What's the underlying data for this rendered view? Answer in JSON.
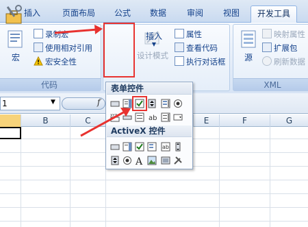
{
  "tabs": [
    {
      "label": "插入",
      "active": false
    },
    {
      "label": "页面布局",
      "active": false
    },
    {
      "label": "公式",
      "active": false
    },
    {
      "label": "数据",
      "active": false
    },
    {
      "label": "审阅",
      "active": false
    },
    {
      "label": "视图",
      "active": false
    },
    {
      "label": "开发工具",
      "active": true
    }
  ],
  "ribbon": {
    "code_group": {
      "label": "代码",
      "macro_button": "宏",
      "record_macro": "录制宏",
      "relative_ref": "使用相对引用",
      "macro_security": "宏安全性"
    },
    "controls_group": {
      "insert_button": "插入",
      "design_mode": "设计模式",
      "properties": "属性",
      "view_code": "查看代码",
      "run_dialog": "执行对话框"
    },
    "xml_group": {
      "label": "XML",
      "source": "源",
      "map_props": "映射属性",
      "expansion_pack": "扩展包",
      "refresh_data": "刷新数据"
    }
  },
  "formula_bar": {
    "name_box": "1",
    "fx": "f"
  },
  "columns": [
    "B",
    "C",
    "E",
    "F",
    "G"
  ],
  "dropdown": {
    "form_controls_title": "表单控件",
    "activex_title": "ActiveX 控件"
  },
  "colors": {
    "highlight": "#e8322f",
    "ribbon_text": "#15428b",
    "insert_active": "#ffc453"
  },
  "icons": {
    "form_controls_row1": [
      "button-icon",
      "combo-box-icon",
      "checkbox-icon",
      "spin-button-icon",
      "list-box-icon",
      "option-button-icon"
    ],
    "form_controls_row2": [
      "group-box-icon",
      "label-icon",
      "scroll-bar-icon",
      "text-field-icon",
      "combo-list-edit-icon",
      "combo-drop-edit-icon"
    ],
    "activex_row1": [
      "command-button-icon",
      "activex-combo-icon",
      "activex-checkbox-icon",
      "activex-listbox-icon",
      "activex-textbox-icon",
      "activex-scrollbar-icon"
    ],
    "activex_row2": [
      "activex-spin-icon",
      "activex-option-icon",
      "activex-label-icon",
      "activex-image-icon",
      "activex-toggle-icon",
      "more-controls-icon"
    ]
  }
}
